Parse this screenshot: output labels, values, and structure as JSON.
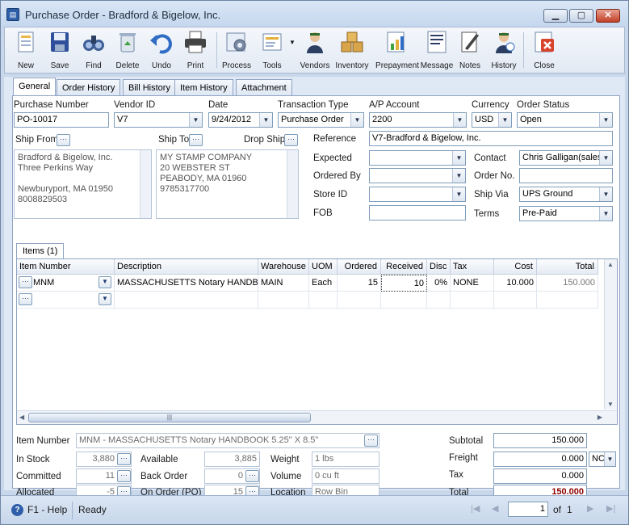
{
  "window": {
    "title": "Purchase Order - Bradford & Bigelow, Inc.",
    "icon": "app-document-icon"
  },
  "toolbar": {
    "items": [
      {
        "label": "New",
        "icon": "new-icon"
      },
      {
        "label": "Save",
        "icon": "save-icon"
      },
      {
        "label": "Find",
        "icon": "binoculars-icon"
      },
      {
        "label": "Delete",
        "icon": "recycle-bin-icon"
      },
      {
        "label": "Undo",
        "icon": "undo-icon"
      },
      {
        "label": "Print",
        "icon": "printer-icon"
      },
      {
        "label": "Process",
        "icon": "process-icon"
      },
      {
        "label": "Tools",
        "icon": "tools-icon"
      },
      {
        "label": "Vendors",
        "icon": "vendor-person-icon"
      },
      {
        "label": "Inventory",
        "icon": "boxes-icon"
      },
      {
        "label": "Prepayment",
        "icon": "prepayment-icon"
      },
      {
        "label": "Message",
        "icon": "message-icon"
      },
      {
        "label": "Notes",
        "icon": "notes-icon"
      },
      {
        "label": "History",
        "icon": "history-icon"
      },
      {
        "label": "Close",
        "icon": "close-doc-icon"
      }
    ]
  },
  "tabs": [
    "General",
    "Order History",
    "Bill History",
    "Item History",
    "Attachment"
  ],
  "header": {
    "purchase_number_label": "Purchase Number",
    "purchase_number": "PO-10017",
    "vendor_id_label": "Vendor ID",
    "vendor_id": "V7",
    "date_label": "Date",
    "date": "9/24/2012",
    "transaction_type_label": "Transaction Type",
    "transaction_type": "Purchase Order",
    "ap_account_label": "A/P Account",
    "ap_account": "2200",
    "currency_label": "Currency",
    "currency": "USD",
    "order_status_label": "Order Status",
    "order_status": "Open"
  },
  "ship": {
    "ship_from_label": "Ship From",
    "ship_from_lines": [
      "Bradford & Bigelow, Inc.",
      "Three Perkins Way",
      "",
      "Newburyport, MA 01950",
      "8008829503"
    ],
    "ship_to_label": "Ship To",
    "drop_ship_label": "Drop Ship",
    "ship_to_lines": [
      "MY STAMP COMPANY",
      "20 WEBSTER ST",
      "PEABODY, MA 01960",
      "9785317700"
    ]
  },
  "details": {
    "reference_label": "Reference",
    "reference": "V7-Bradford & Bigelow, Inc.",
    "expected_label": "Expected",
    "expected": "",
    "ordered_by_label": "Ordered By",
    "ordered_by": "",
    "store_id_label": "Store ID",
    "store_id": "",
    "fob_label": "FOB",
    "fob": "",
    "contact_label": "Contact",
    "contact": "Chris Galligan(sales",
    "order_no_label": "Order No.",
    "order_no": "",
    "ship_via_label": "Ship Via",
    "ship_via": "UPS Ground",
    "terms_label": "Terms",
    "terms": "Pre-Paid"
  },
  "items_tab": "Items (1)",
  "grid": {
    "columns": [
      "Item Number",
      "Description",
      "Warehouse",
      "UOM",
      "Ordered",
      "Received",
      "Disc",
      "Tax",
      "Cost",
      "Total"
    ],
    "rows": [
      {
        "item": "MNM",
        "description": "MASSACHUSETTS Notary HANDBOO",
        "warehouse": "MAIN",
        "uom": "Each",
        "ordered": "15",
        "received": "10",
        "disc": "0%",
        "tax": "NONE",
        "cost": "10.000",
        "total": "150.000"
      }
    ]
  },
  "footer": {
    "item_number_label": "Item Number",
    "item_number": "MNM - MASSACHUSETTS Notary HANDBOOK  5.25\" X 8.5\"",
    "in_stock_label": "In Stock",
    "in_stock": "3,880",
    "committed_label": "Committed",
    "committed": "11",
    "allocated_label": "Allocated",
    "allocated": "-5",
    "available_label": "Available",
    "available": "3,885",
    "back_order_label": "Back Order",
    "back_order": "0",
    "on_order_label": "On Order (PO)",
    "on_order": "15",
    "weight_label": "Weight",
    "weight": "1 lbs",
    "volume_label": "Volume",
    "volume": "0 cu ft",
    "location_label": "Location",
    "location": "Row  Bin",
    "subtotal_label": "Subtotal",
    "subtotal": "150.000",
    "freight_label": "Freight",
    "freight": "0.000",
    "freight_code": "NC",
    "tax_label": "Tax",
    "tax": "0.000",
    "total_label": "Total",
    "total": "150.000"
  },
  "status": {
    "help": "F1 - Help",
    "state": "Ready",
    "page": "1",
    "of_label": "of",
    "page_count": "1"
  },
  "colors": {
    "total_red": "#8b0000",
    "accent": "#2d5fa8"
  }
}
